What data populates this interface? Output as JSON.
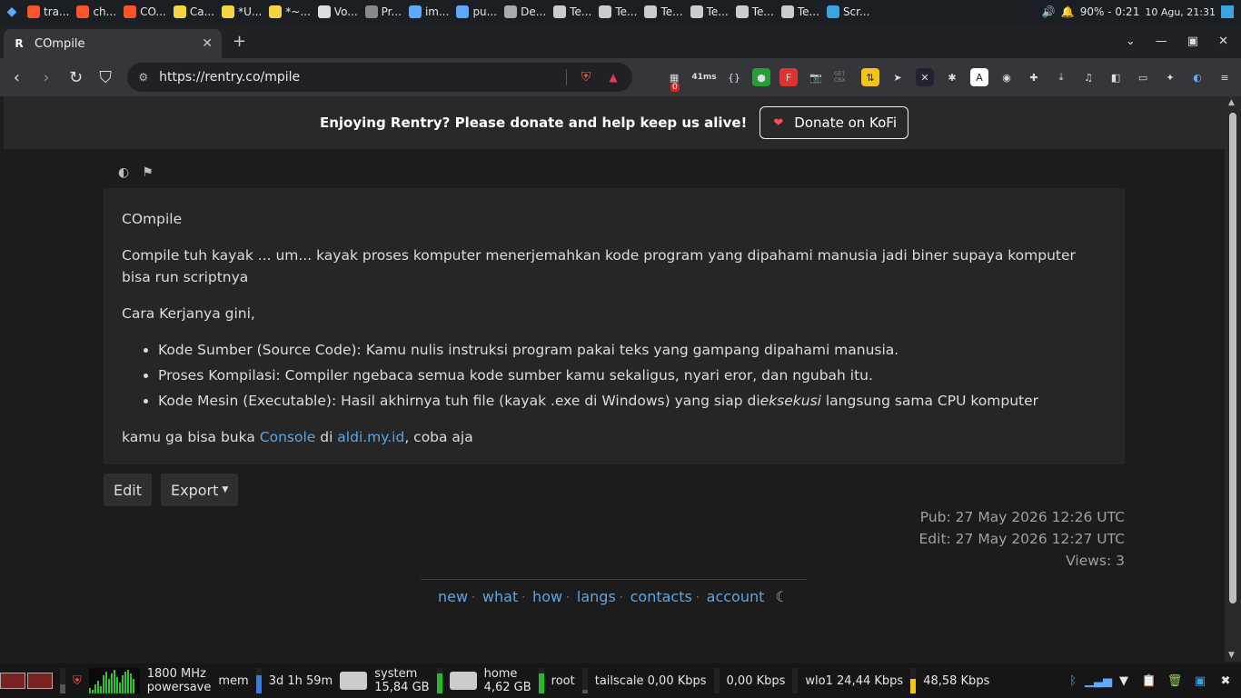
{
  "os_top": {
    "tasks": [
      {
        "label": "tra...",
        "color": "#fb542b"
      },
      {
        "label": "ch...",
        "color": "#fb542b"
      },
      {
        "label": "CO...",
        "color": "#fb542b"
      },
      {
        "label": "Ca...",
        "color": "#f5d442"
      },
      {
        "label": "*U...",
        "color": "#f5d442"
      },
      {
        "label": "*~...",
        "color": "#f5d442"
      },
      {
        "label": "Vo...",
        "color": "#ddd"
      },
      {
        "label": "Pr...",
        "color": "#888"
      },
      {
        "label": "im...",
        "color": "#5fa8ff"
      },
      {
        "label": "pu...",
        "color": "#5fa8ff"
      },
      {
        "label": "De...",
        "color": "#aaa"
      },
      {
        "label": "Te...",
        "color": "#ccc"
      },
      {
        "label": "Te...",
        "color": "#ccc"
      },
      {
        "label": "Te...",
        "color": "#ccc"
      },
      {
        "label": "Te...",
        "color": "#ccc"
      },
      {
        "label": "Te...",
        "color": "#ccc"
      },
      {
        "label": "Te...",
        "color": "#ccc"
      },
      {
        "label": "Scr...",
        "color": "#3aa6e0"
      }
    ],
    "battery": "90% - 0:21",
    "clock": "10 Agu, 21:31"
  },
  "browser": {
    "tab_title": "COmpile",
    "url": "https://rentry.co/mpile",
    "extension_badges": {
      "notif_count": "0",
      "ping": "41ms"
    }
  },
  "banner": {
    "message": "Enjoying Rentry? Please donate and help keep us alive!",
    "donate_label": "Donate on KoFi"
  },
  "article": {
    "title": "COmpile",
    "intro": "Compile tuh kayak ... um... kayak proses komputer menerjemahkan kode program yang dipahami manusia jadi biner supaya komputer bisa run scriptnya",
    "how_it_works": "Cara Kerjanya gini,",
    "items": [
      "Kode Sumber (Source Code): Kamu nulis instruksi program pakai teks yang gampang dipahami manusia.",
      "Proses Kompilasi: Compiler ngebaca semua kode sumber kamu sekaligus, nyari eror, dan ngubah itu."
    ],
    "item3_before": "Kode Mesin (Executable): Hasil akhirnya tuh file (kayak .exe di Windows) yang siap di",
    "item3_em": "eksekusi",
    "item3_after": " langsung sama CPU komputer",
    "closing_before": "kamu ga bisa buka ",
    "closing_link1": "Console",
    "closing_mid": " di ",
    "closing_link2": "aldi.my.id",
    "closing_after": ", coba aja"
  },
  "actions": {
    "edit": "Edit",
    "export": "Export"
  },
  "meta": {
    "pub": "Pub: 27 May 2026 12:26 UTC",
    "edit": "Edit: 27 May 2026 12:27 UTC",
    "views": "Views: 3"
  },
  "footer": {
    "links": [
      "new",
      "what",
      "how",
      "langs",
      "contacts",
      "account"
    ]
  },
  "os_bottom": {
    "cpu_freq": "1800 MHz",
    "cpu_gov": "powersave",
    "mem_label": "mem",
    "uptime": "3d 1h 59m",
    "system_label": "system",
    "system_size": "15,84 GB",
    "home_label": "home",
    "home_size": "4,62 GB",
    "root_label": "root",
    "tailscale": "tailscale 0,00 Kbps",
    "tailscale2": "0,00 Kbps",
    "wlo1_up": "wlo1 24,44 Kbps",
    "wlo1_down": "48,58 Kbps"
  },
  "colors": {
    "link": "#5aa6e6",
    "brand_red": "#fb542b"
  }
}
